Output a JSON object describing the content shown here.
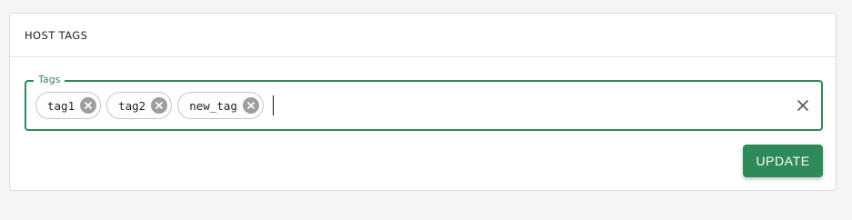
{
  "card": {
    "title": "HOST TAGS"
  },
  "tags_field": {
    "legend": "Tags",
    "tags": [
      {
        "label": "tag1"
      },
      {
        "label": "tag2"
      },
      {
        "label": "new_tag"
      }
    ],
    "input_value": "",
    "clear_icon": "close-icon",
    "chip_remove_icon": "cancel-circle-icon"
  },
  "actions": {
    "update_label": "UPDATE"
  },
  "colors": {
    "accent": "#2e8b57",
    "chip_remove": "#9e9e9e",
    "background": "#f5f5f5"
  }
}
